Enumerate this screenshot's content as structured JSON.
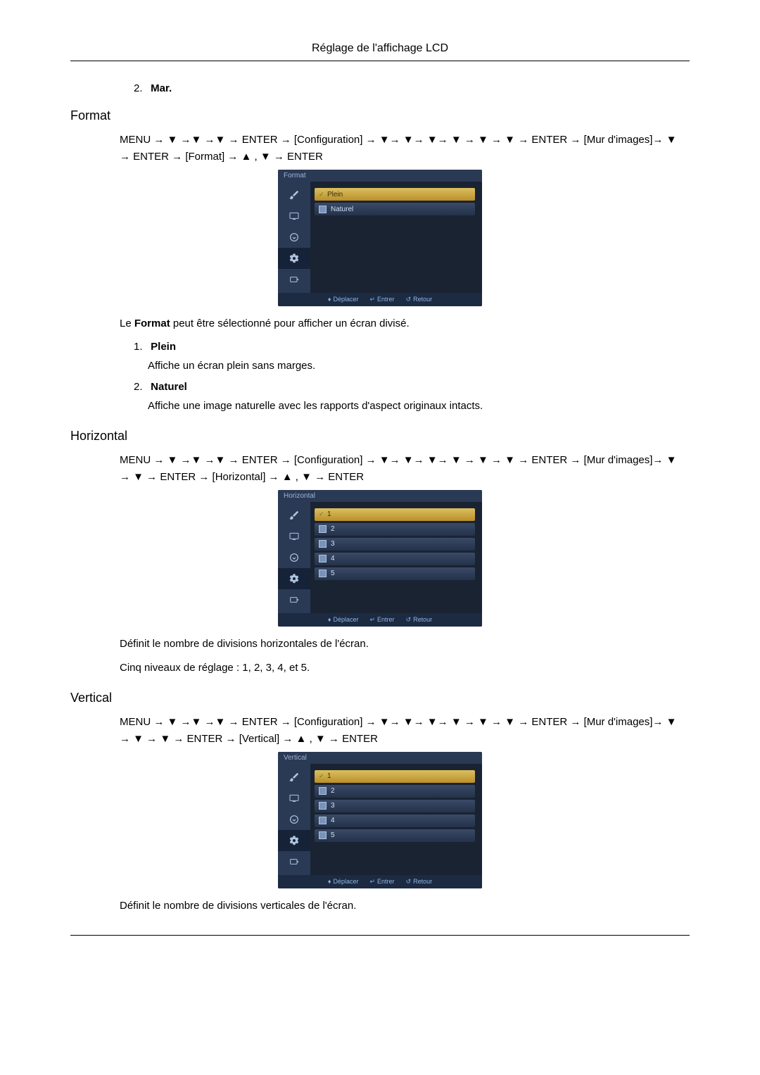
{
  "header": {
    "title": "Réglage de l'affichage LCD"
  },
  "preList": {
    "num": "2.",
    "label": "Mar."
  },
  "sections": [
    {
      "title": "Format",
      "navPath": "MENU → ▼ →▼ →▼ → ENTER → [Configuration] → ▼→ ▼→ ▼→ ▼ → ▼ → ▼ → ENTER → [Mur d'images]→ ▼ → ENTER → [Format] → ▲ , ▼ → ENTER",
      "osd": {
        "title": "Format",
        "items": [
          {
            "label": "Plein",
            "selected": true
          },
          {
            "label": "Naturel",
            "selected": false
          }
        ],
        "footer": {
          "move": "Déplacer",
          "enter": "Entrer",
          "return": "Retour"
        }
      },
      "afterText": {
        "pre": "Le ",
        "bold": "Format",
        "post": " peut être sélectionné pour afficher un écran divisé."
      },
      "subitems": [
        {
          "num": "1.",
          "title": "Plein",
          "desc": "Affiche un écran plein sans marges."
        },
        {
          "num": "2.",
          "title": "Naturel",
          "desc": "Affiche une image naturelle avec les rapports d'aspect originaux intacts."
        }
      ]
    },
    {
      "title": "Horizontal",
      "navPath": "MENU → ▼ →▼ →▼ → ENTER → [Configuration] → ▼→ ▼→ ▼→ ▼ → ▼ → ▼ → ENTER → [Mur d'images]→ ▼ → ▼ → ENTER → [Horizontal] → ▲ , ▼ → ENTER",
      "osd": {
        "title": "Horizontal",
        "items": [
          {
            "label": "1",
            "selected": true
          },
          {
            "label": "2",
            "selected": false
          },
          {
            "label": "3",
            "selected": false
          },
          {
            "label": "4",
            "selected": false
          },
          {
            "label": "5",
            "selected": false
          }
        ],
        "footer": {
          "move": "Déplacer",
          "enter": "Entrer",
          "return": "Retour"
        }
      },
      "bodyTexts": [
        "Définit le nombre de divisions horizontales de l'écran.",
        "Cinq niveaux de réglage : 1, 2, 3, 4, et 5."
      ]
    },
    {
      "title": "Vertical",
      "navPath": "MENU → ▼ →▼ →▼ → ENTER → [Configuration] → ▼→ ▼→ ▼→ ▼ → ▼ → ▼ → ENTER → [Mur d'images]→ ▼ → ▼ → ▼ → ENTER → [Vertical] → ▲ , ▼ → ENTER",
      "osd": {
        "title": "Vertical",
        "items": [
          {
            "label": "1",
            "selected": true
          },
          {
            "label": "2",
            "selected": false
          },
          {
            "label": "3",
            "selected": false
          },
          {
            "label": "4",
            "selected": false
          },
          {
            "label": "5",
            "selected": false
          }
        ],
        "footer": {
          "move": "Déplacer",
          "enter": "Entrer",
          "return": "Retour"
        }
      },
      "bodyTexts": [
        "Définit le nombre de divisions verticales de l'écran."
      ]
    }
  ],
  "iconsSvg": {
    "brush": "brush-icon",
    "screen": "screen-icon",
    "circle": "circle-arrow-icon",
    "gear": "gear-icon",
    "input": "input-icon"
  }
}
